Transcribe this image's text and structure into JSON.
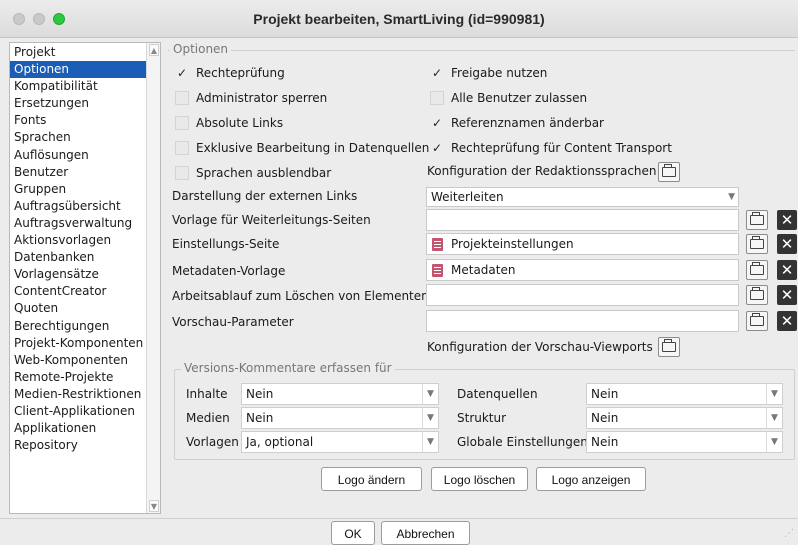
{
  "window": {
    "title": "Projekt bearbeiten, SmartLiving (id=990981)"
  },
  "nav": {
    "items": [
      "Projekt",
      "Optionen",
      "Kompatibilität",
      "Ersetzungen",
      "Fonts",
      "Sprachen",
      "Auflösungen",
      "Benutzer",
      "Gruppen",
      "Auftragsübersicht",
      "Auftragsverwaltung",
      "Aktionsvorlagen",
      "Datenbanken",
      "Vorlagensätze",
      "ContentCreator",
      "Quoten",
      "Berechtigungen",
      "Projekt-Komponenten",
      "Web-Komponenten",
      "Remote-Projekte",
      "Medien-Restriktionen",
      "Client-Applikationen",
      "Applikationen",
      "Repository"
    ],
    "selected": "Optionen"
  },
  "options": {
    "legend": "Optionen",
    "checkboxes_left": [
      {
        "label": "Rechteprüfung",
        "checked": true
      },
      {
        "label": "Administrator sperren",
        "checked": false
      },
      {
        "label": "Absolute Links",
        "checked": false
      },
      {
        "label": "Exklusive Bearbeitung in Datenquellen",
        "checked": false
      },
      {
        "label": "Sprachen ausblendbar",
        "checked": false
      }
    ],
    "checkboxes_right": [
      {
        "label": "Freigabe nutzen",
        "checked": true
      },
      {
        "label": "Alle Benutzer zulassen",
        "checked": false
      },
      {
        "label": "Referenznamen änderbar",
        "checked": true
      },
      {
        "label": "Rechteprüfung für Content Transport",
        "checked": true
      }
    ],
    "redaktionssprachen_label": "Konfiguration der Redaktionssprachen",
    "externe_links_label": "Darstellung der externen Links",
    "externe_links_value": "Weiterleiten",
    "weiterleitung_label": "Vorlage für Weiterleitungs-Seiten",
    "weiterleitung_value": "",
    "einstellungs_label": "Einstellungs-Seite",
    "einstellungs_value": "Projekteinstellungen",
    "metadaten_label": "Metadaten-Vorlage",
    "metadaten_value": "Metadaten",
    "arbeitsablauf_label": "Arbeitsablauf zum Löschen von Elementen",
    "arbeitsablauf_value": "",
    "vorschau_label": "Vorschau-Parameter",
    "vorschau_value": "",
    "viewports_label": "Konfiguration der Vorschau-Viewports"
  },
  "versions": {
    "legend": "Versions-Kommentare erfassen für",
    "inhalte_label": "Inhalte",
    "inhalte_value": "Nein",
    "medien_label": "Medien",
    "medien_value": "Nein",
    "vorlagen_label": "Vorlagen",
    "vorlagen_value": "Ja, optional",
    "datenquellen_label": "Datenquellen",
    "datenquellen_value": "Nein",
    "struktur_label": "Struktur",
    "struktur_value": "Nein",
    "global_label": "Globale Einstellungen",
    "global_value": "Nein"
  },
  "logo": {
    "change": "Logo ändern",
    "delete": "Logo löschen",
    "show": "Logo anzeigen"
  },
  "footer": {
    "ok": "OK",
    "cancel": "Abbrechen"
  }
}
